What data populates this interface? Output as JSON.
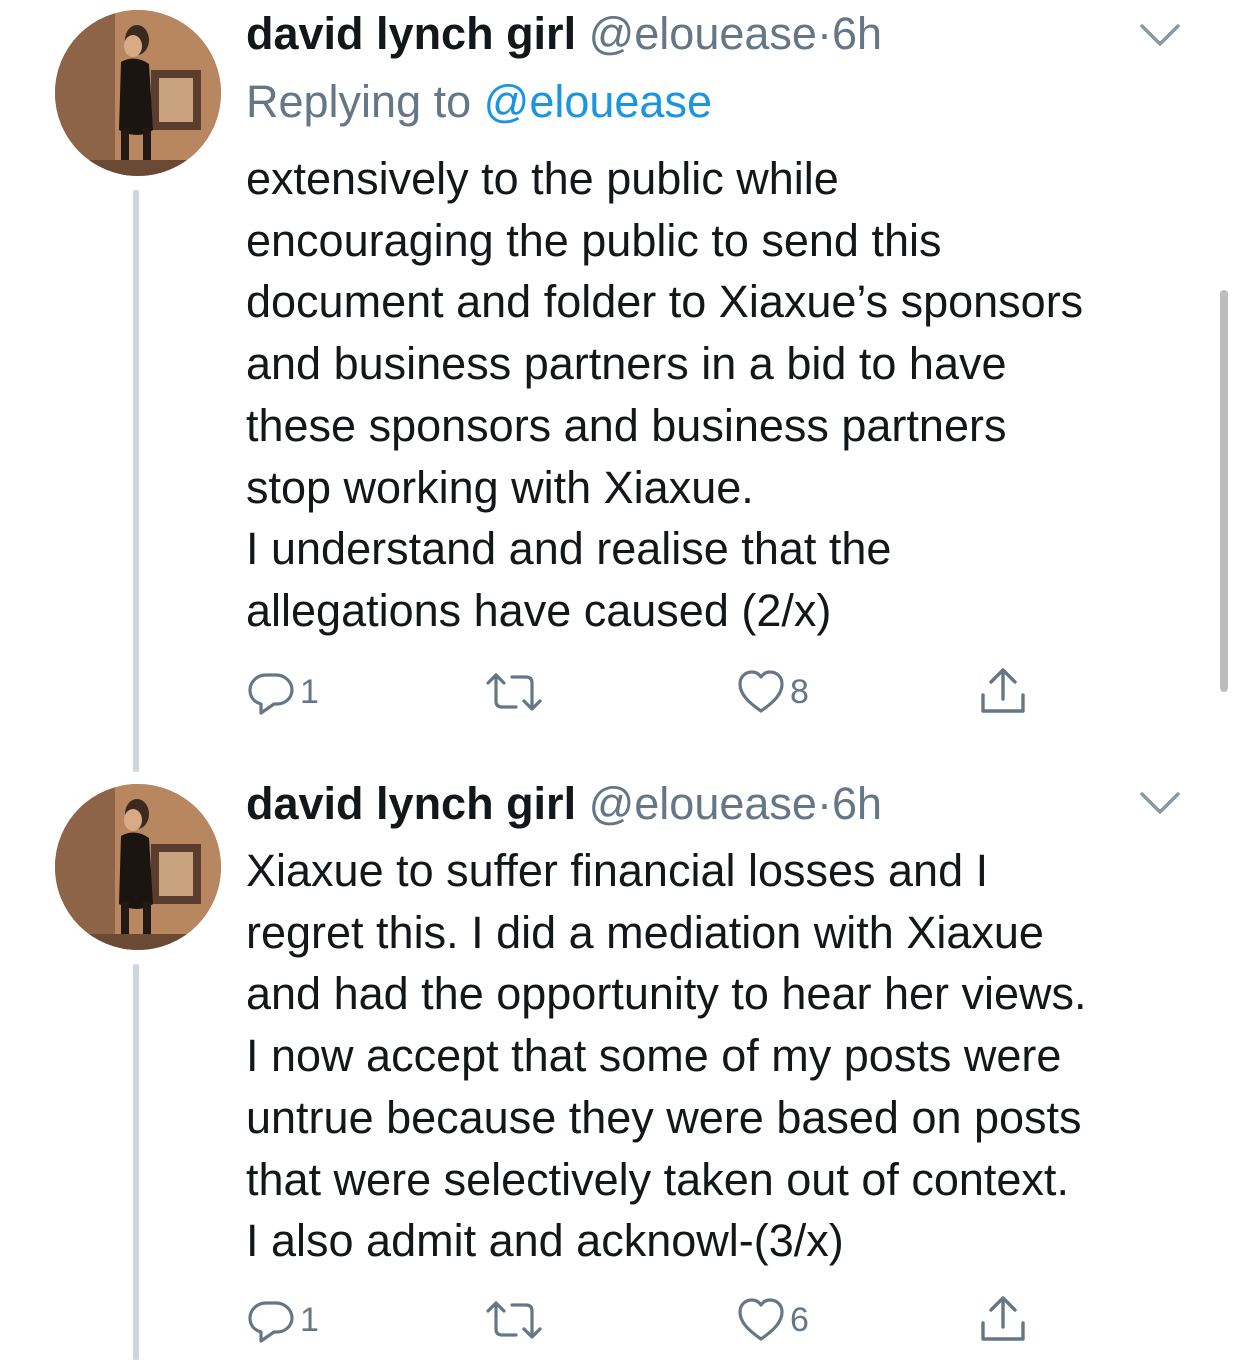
{
  "theme": {
    "text_color": "#14171a",
    "secondary_color": "#657786",
    "link_color": "#1b95e0",
    "thread_line_color": "#ccd6dd"
  },
  "tweets": [
    {
      "display_name": "david lynch girl",
      "handle": "@elouease",
      "separator": "·",
      "time": "6h",
      "replying_prefix": "Replying to ",
      "replying_to": "@elouease",
      "body_lines": [
        "extensively to the public while",
        "encouraging the public to send this",
        "document and folder to Xiaxue’s sponsors",
        "and business partners in a bid to have",
        "these sponsors and business partners",
        "stop working with Xiaxue.",
        "I understand and realise that the",
        "allegations have caused (2/x)"
      ],
      "reply_count": "1",
      "retweet_count": "",
      "like_count": "8",
      "icons": {
        "reply": "reply-icon",
        "retweet": "retweet-icon",
        "like": "heart-icon",
        "share": "share-icon",
        "menu": "chevron-down-icon"
      }
    },
    {
      "display_name": "david lynch girl",
      "handle": "@elouease",
      "separator": "·",
      "time": "6h",
      "body_lines": [
        "Xiaxue to suffer financial losses and I",
        "regret this. I did a mediation with Xiaxue",
        "and had the opportunity to hear her views.",
        "I now accept that some of my posts were",
        "untrue because they were based on posts",
        "that were selectively taken out of context.",
        "I also admit and acknowl-(3/x)"
      ],
      "reply_count": "1",
      "retweet_count": "",
      "like_count": "6",
      "icons": {
        "reply": "reply-icon",
        "retweet": "retweet-icon",
        "like": "heart-icon",
        "share": "share-icon",
        "menu": "chevron-down-icon"
      }
    }
  ]
}
